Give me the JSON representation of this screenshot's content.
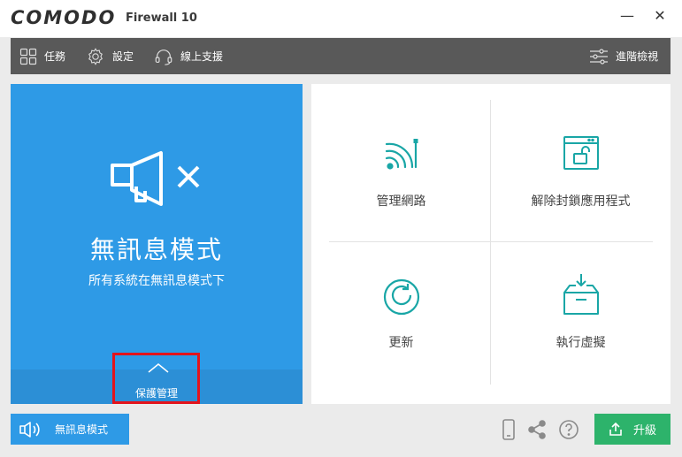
{
  "window": {
    "logo": "COMODO",
    "product": "Firewall  10",
    "minimize_glyph": "—",
    "close_glyph": "✕"
  },
  "toolbar": {
    "tasks_label": "任務",
    "settings_label": "設定",
    "support_label": "線上支援",
    "advanced_label": "進階檢視"
  },
  "status_panel": {
    "title": "無訊息模式",
    "subtitle": "所有系統在無訊息模式下",
    "protection_label": "保護管理",
    "color": "#2e9ae6"
  },
  "tiles": [
    {
      "label": "管理網路",
      "icon": "wifi-network-icon"
    },
    {
      "label": "解除封鎖應用程式",
      "icon": "unlock-app-icon"
    },
    {
      "label": "更新",
      "icon": "refresh-icon"
    },
    {
      "label": "執行虛擬",
      "icon": "virtual-box-icon"
    }
  ],
  "bottom": {
    "silent_mode_label": "無訊息模式",
    "upgrade_label": "升級",
    "icons": [
      "mobile-icon",
      "share-icon",
      "help-icon"
    ],
    "upgrade_color": "#2db36b"
  },
  "colors": {
    "accent": "#2e9ae6",
    "toolbar": "#595959",
    "tile_icon": "#19a6a6",
    "highlight": "#e3141c"
  }
}
